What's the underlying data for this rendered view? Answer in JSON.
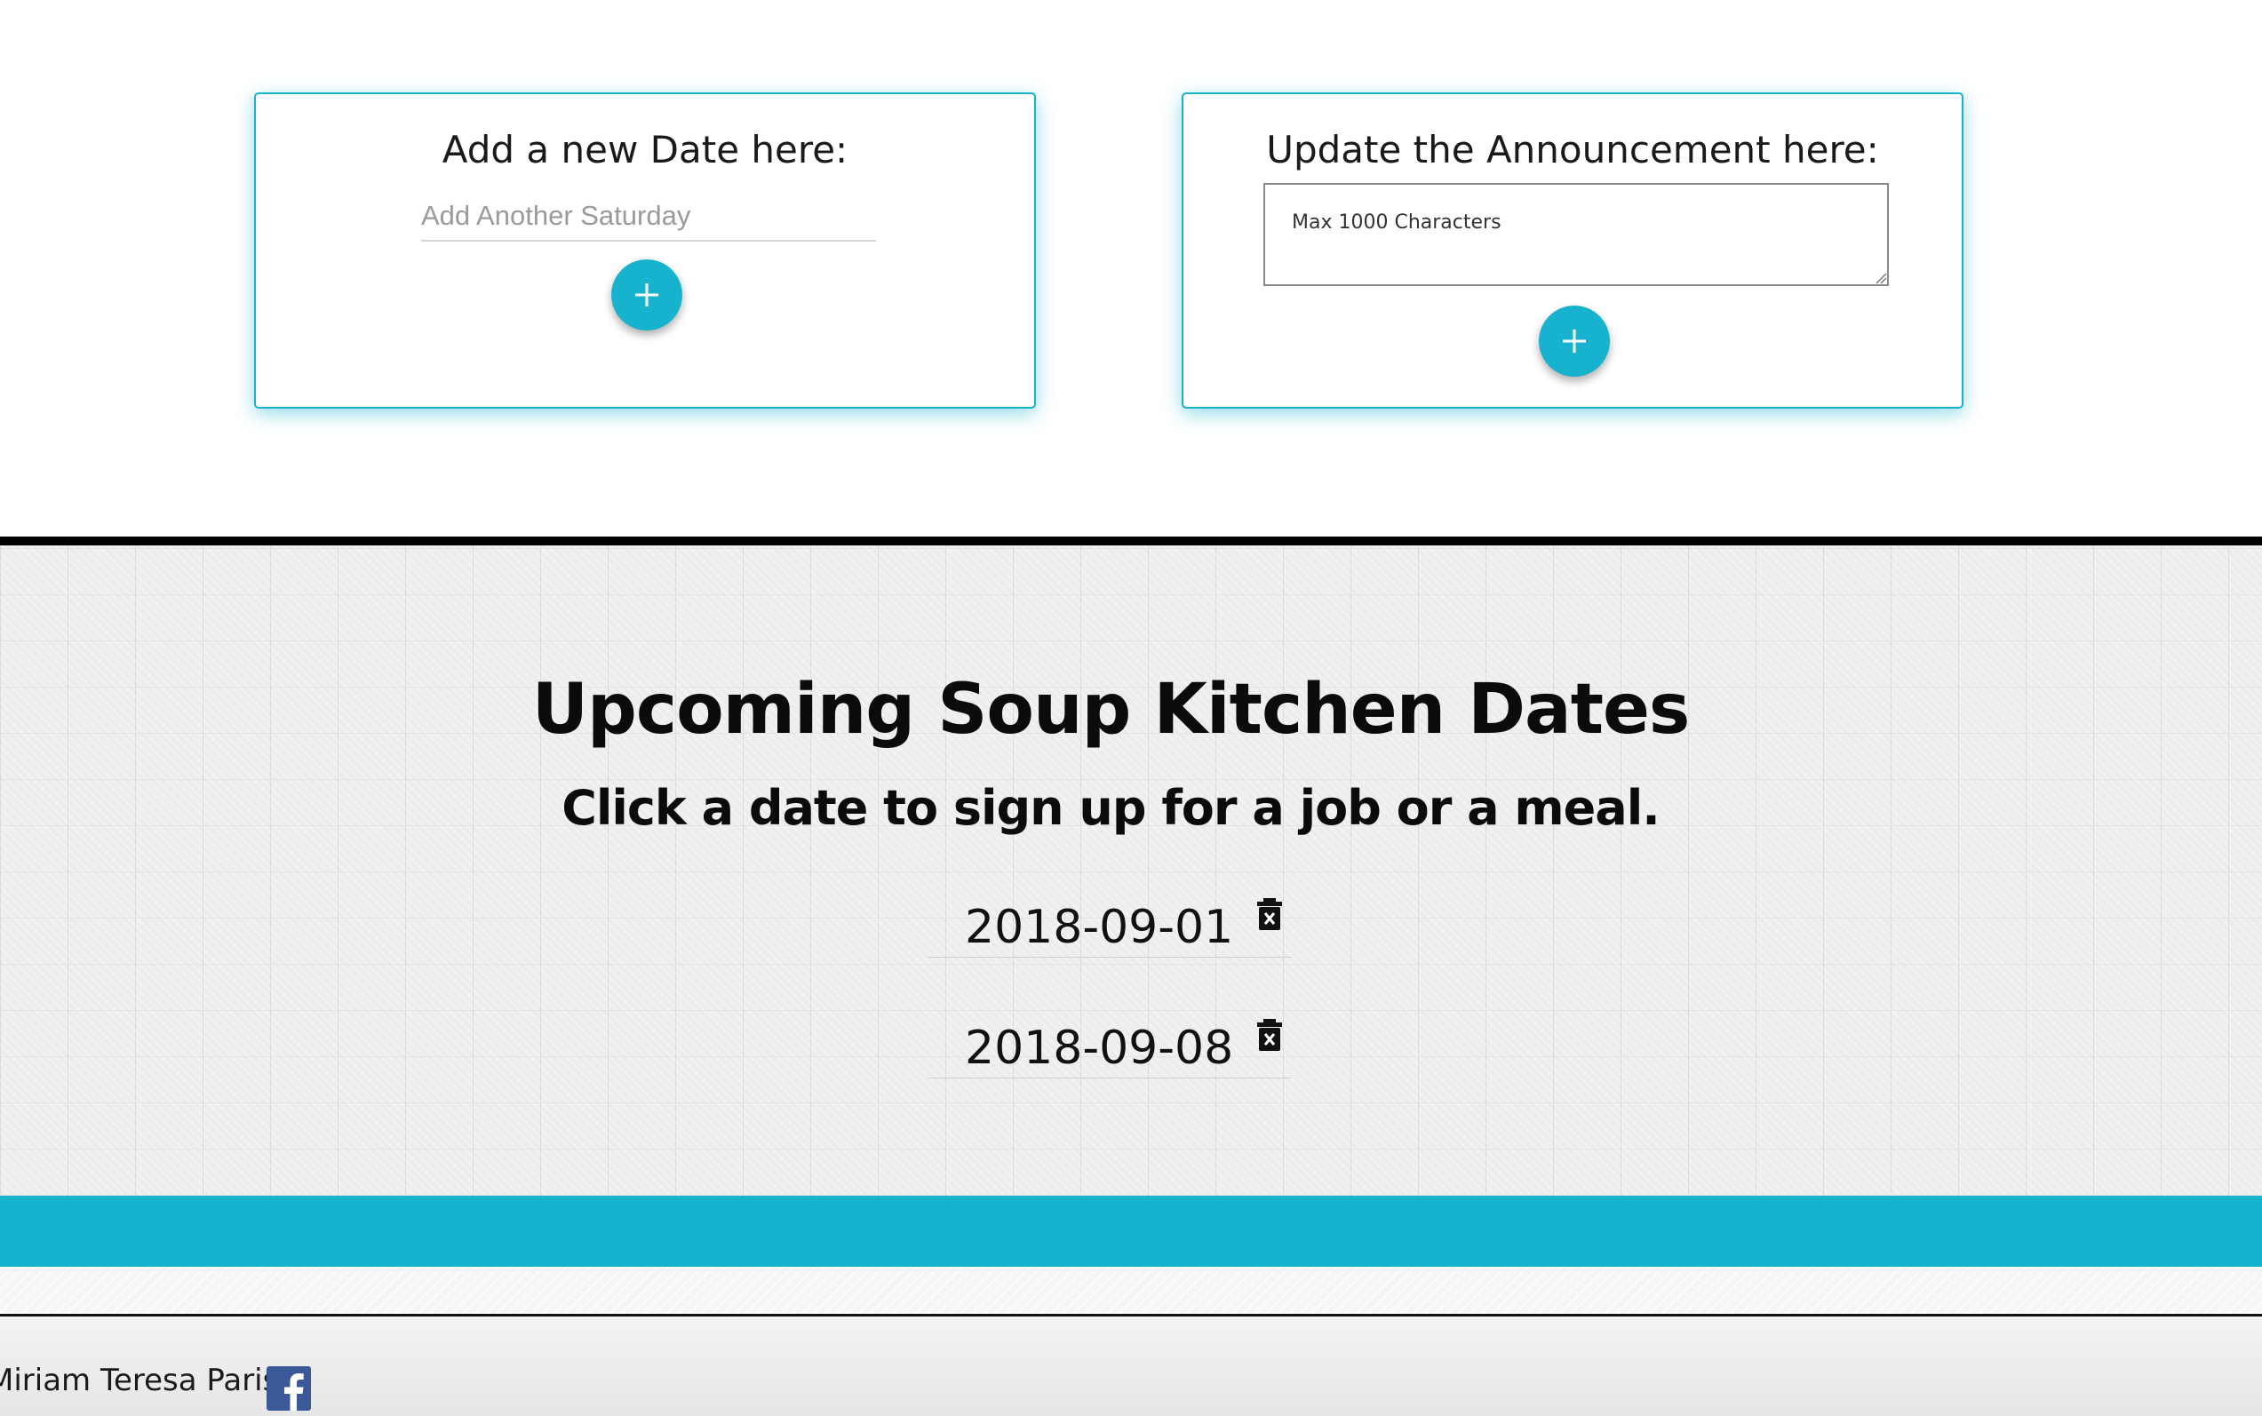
{
  "add_date_card": {
    "title": "Add a new Date here:",
    "input_placeholder": "Add Another Saturday",
    "input_value": "",
    "add_button_icon": "plus-icon"
  },
  "announcement_card": {
    "title": "Update the Announcement here:",
    "textarea_placeholder": "Max 1000 Characters",
    "textarea_value": "",
    "add_button_icon": "plus-icon"
  },
  "dates_section": {
    "title": "Upcoming Soup Kitchen Dates",
    "subtitle": "Click a date to sign up for a job or a meal.",
    "dates": [
      {
        "label": "2018-09-01",
        "delete_icon": "trash-icon"
      },
      {
        "label": "2018-09-08",
        "delete_icon": "trash-icon"
      }
    ]
  },
  "footer": {
    "text": "Miriam Teresa Parish",
    "social_icon": "facebook-icon"
  },
  "colors": {
    "accent": "#17b2cd",
    "text": "#111111",
    "facebook": "#3b5998"
  }
}
